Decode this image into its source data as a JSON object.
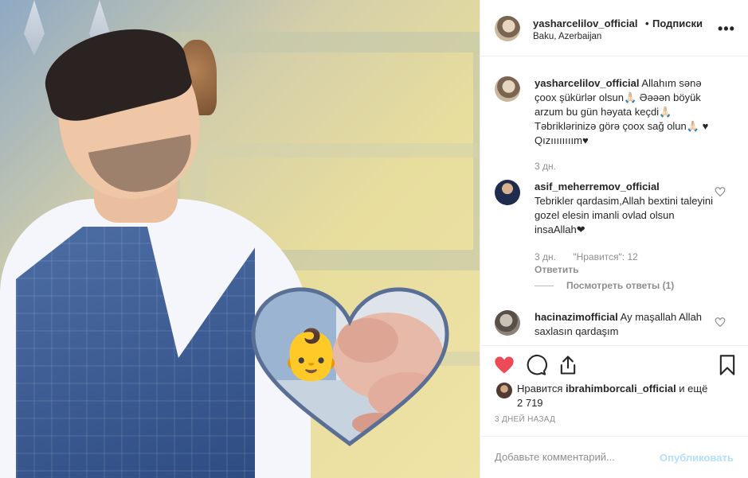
{
  "post": {
    "username": "yasharcelilov_official",
    "separator": "•",
    "follow_label": "Подписки",
    "location": "Baku, Azerbaijan",
    "more_icon": "more-horizontal-icon"
  },
  "photo": {
    "overlay_emoji": "👶",
    "colors": {
      "vest": "#3b5c93",
      "shirt": "#f4f6fb",
      "heart_border": "#5a6f95"
    }
  },
  "caption": {
    "username": "yasharcelilov_official",
    "text": "Allahım sənə çoox şükürlər olsun🙏🏻 Əəəən böyük arzum bu gün həyata keçdi🙏🏻 Təbriklərinizə görə çoox sağ olun🙏🏻 ♥ Qızıııııııım♥",
    "time": "3 дн."
  },
  "comments": [
    {
      "username": "asif_meherremov_official",
      "text": "Tebrikler qardasim,Allah bextini taleyini gozel elesin imanli ovlad olsun insaAllah❤",
      "time": "3 дн.",
      "likes": "\"Нравится\": 12",
      "reply_label": "Ответить",
      "view_replies": "Посмотреть ответы (1)"
    },
    {
      "username": "hacinazimofficial",
      "text": "Ay maşallah Allah saxlasın qardaşım"
    }
  ],
  "actions": {
    "like_icon": "heart-filled-icon",
    "comment_icon": "comment-icon",
    "share_icon": "share-icon",
    "save_icon": "bookmark-icon",
    "like_color": "#ed4956"
  },
  "likes": {
    "prefix": "Нравится ",
    "user": "ibrahimborcali_official",
    "suffix": " и ещё 2 719"
  },
  "date": "3 ДНЕЙ НАЗАД",
  "add_comment": {
    "placeholder": "Добавьте комментарий...",
    "publish_label": "Опубликовать"
  }
}
